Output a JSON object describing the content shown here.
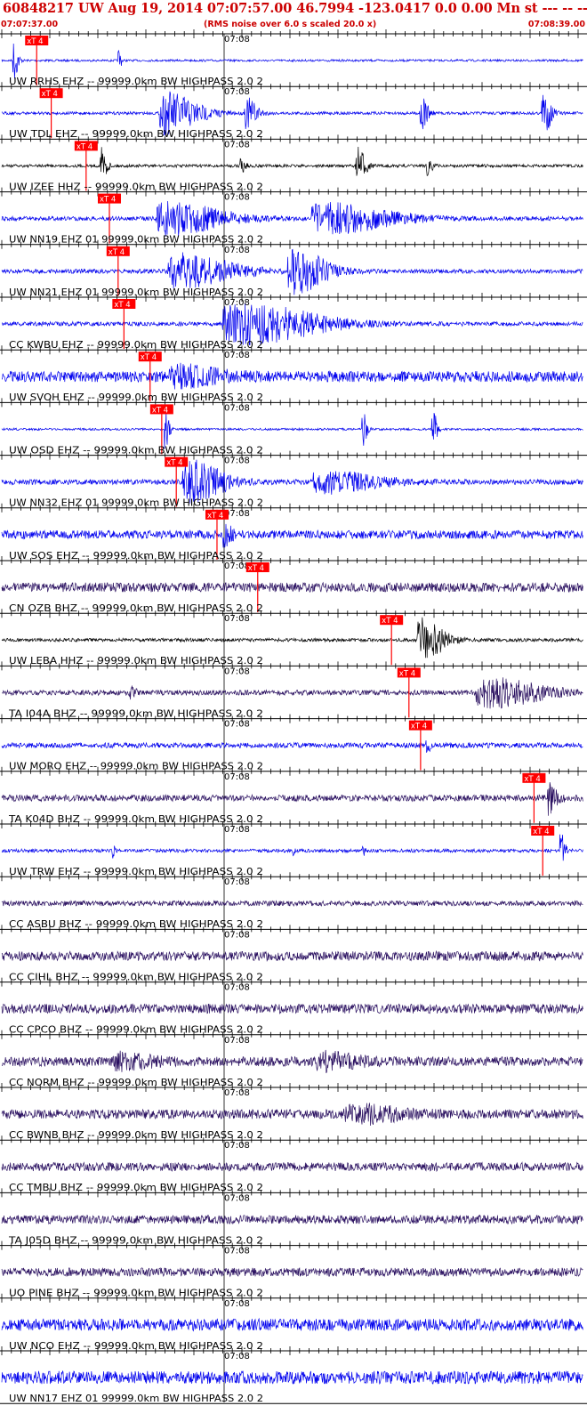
{
  "header": {
    "title": "60848217 UW Aug 19, 2014 07:07:57.00   46.7994 -123.0417  0.0 0.00 Mn st --- -- --  -1",
    "start_time": "07:07:37.00",
    "scale_note": "(RMS noise over 6.0 s scaled 20.0 x)",
    "end_time": "07:08:39.00"
  },
  "time_tick_label": "07:08",
  "pick_label": "xT 4",
  "colors": {
    "header_red": "#cc0000",
    "blue_trace": "#0000ee",
    "black_trace": "#000000",
    "purple_trace": "#2a1060",
    "pick_red": "#ff0000",
    "grid": "#000000"
  },
  "traces": [
    {
      "label": "UW RRHS EHZ -- 99999.0km BW  HIGHPASS  2.0  2",
      "color": "blue",
      "noise": 0.05,
      "bursts": [
        [
          0.02,
          0.8,
          1.0
        ],
        [
          0.2,
          0.5,
          0.6
        ]
      ],
      "pick": 0.06
    },
    {
      "label": "UW TDL EHZ -- 99999.0km BW  HIGHPASS  2.0  2",
      "color": "blue",
      "noise": 0.07,
      "bursts": [
        [
          0.28,
          6.0,
          1.0
        ],
        [
          0.42,
          2.0,
          0.7
        ],
        [
          0.72,
          1.2,
          0.9
        ],
        [
          0.93,
          1.5,
          1.0
        ]
      ],
      "pick": 0.085
    },
    {
      "label": "UW IZEE HHZ -- 99999.0km BW  HIGHPASS  2.0  2",
      "color": "black",
      "noise": 0.07,
      "bursts": [
        [
          0.17,
          1.0,
          1.0
        ],
        [
          0.41,
          0.8,
          0.5
        ],
        [
          0.61,
          1.5,
          0.9
        ],
        [
          0.73,
          1.0,
          0.5
        ]
      ],
      "pick": 0.145
    },
    {
      "label": "UW NN19 EHZ 01 99999.0km BW  HIGHPASS  2.0  2",
      "color": "blue",
      "noise": 0.1,
      "bursts": [
        [
          0.28,
          10.0,
          0.8
        ],
        [
          0.55,
          12.0,
          0.7
        ]
      ],
      "pick": 0.185
    },
    {
      "label": "UW NN21 EHZ 01 99999.0km BW  HIGHPASS  2.0  2",
      "color": "blue",
      "noise": 0.1,
      "bursts": [
        [
          0.3,
          10.0,
          0.8
        ],
        [
          0.5,
          6.0,
          1.0
        ]
      ],
      "pick": 0.2
    },
    {
      "label": "CC KWBU EHZ -- 99999.0km BW  HIGHPASS  2.0  2",
      "color": "blue",
      "noise": 0.1,
      "bursts": [
        [
          0.4,
          14.0,
          1.0
        ]
      ],
      "pick": 0.21
    },
    {
      "label": "UW SVOH EHZ -- 99999.0km BW  HIGHPASS  2.0  2",
      "color": "blue",
      "noise": 0.25,
      "bursts": [
        [
          0.3,
          8.0,
          0.4
        ]
      ],
      "pick": 0.255
    },
    {
      "label": "UW OSD EHZ -- 99999.0km BW  HIGHPASS  2.0  2",
      "color": "blue",
      "noise": 0.05,
      "bursts": [
        [
          0.28,
          0.8,
          0.9
        ],
        [
          0.62,
          0.8,
          0.9
        ],
        [
          0.74,
          0.8,
          1.0
        ]
      ],
      "pick": 0.275
    },
    {
      "label": "UW NN32 EHZ 01 99999.0km BW  HIGHPASS  2.0  2",
      "color": "blue",
      "noise": 0.12,
      "bursts": [
        [
          0.32,
          6.0,
          1.0
        ],
        [
          0.55,
          10.0,
          0.5
        ]
      ],
      "pick": 0.3
    },
    {
      "label": "UW SOS EHZ -- 99999.0km BW  HIGHPASS  2.0  2",
      "color": "blue",
      "noise": 0.2,
      "bursts": [
        [
          0.38,
          1.5,
          0.5
        ]
      ],
      "pick": 0.37
    },
    {
      "label": "CN OZB BHZ -- 99999.0km BW  HIGHPASS  2.0  2",
      "color": "purple",
      "noise": 0.22,
      "bursts": [],
      "pick": 0.44
    },
    {
      "label": "UW LEBA HHZ -- 99999.0km BW  HIGHPASS  2.0  2",
      "color": "black",
      "noise": 0.08,
      "bursts": [
        [
          0.72,
          4.0,
          1.0
        ]
      ],
      "pick": 0.67
    },
    {
      "label": "TA I04A BHZ -- 99999.0km BW  HIGHPASS  2.0  2",
      "color": "purple",
      "noise": 0.12,
      "bursts": [
        [
          0.83,
          10.0,
          0.65
        ],
        [
          0.22,
          1.0,
          0.3
        ]
      ],
      "pick": 0.7
    },
    {
      "label": "UW MORO EHZ -- 99999.0km BW  HIGHPASS  2.0  2",
      "color": "blue",
      "noise": 0.12,
      "bursts": [
        [
          0.73,
          0.5,
          0.7
        ]
      ],
      "pick": 0.72
    },
    {
      "label": "TA K04D BHZ -- 99999.0km BW  HIGHPASS  2.0  2",
      "color": "purple",
      "noise": 0.15,
      "bursts": [
        [
          0.94,
          1.5,
          1.0
        ]
      ],
      "pick": 0.915
    },
    {
      "label": "UW TRW EHZ -- 99999.0km BW  HIGHPASS  2.0  2",
      "color": "blue",
      "noise": 0.08,
      "bursts": [
        [
          0.19,
          0.3,
          0.4
        ],
        [
          0.5,
          0.3,
          0.4
        ],
        [
          0.62,
          0.3,
          0.5
        ],
        [
          0.96,
          0.8,
          0.9
        ]
      ],
      "pick": 0.93
    },
    {
      "label": "CC ASBU BHZ -- 99999.0km BW  HIGHPASS  2.0  2",
      "color": "purple",
      "noise": 0.12,
      "bursts": []
    },
    {
      "label": "CC CIHL BHZ -- 99999.0km BW  HIGHPASS  2.0  2",
      "color": "purple",
      "noise": 0.22,
      "bursts": []
    },
    {
      "label": "CC CPCO BHZ -- 99999.0km BW  HIGHPASS  2.0  2",
      "color": "purple",
      "noise": 0.22,
      "bursts": []
    },
    {
      "label": "CC NORM BHZ -- 99999.0km BW  HIGHPASS  2.0  2",
      "color": "purple",
      "noise": 0.22,
      "bursts": [
        [
          0.2,
          6.0,
          0.35
        ],
        [
          0.55,
          6.0,
          0.35
        ]
      ]
    },
    {
      "label": "CC BWNB BHZ -- 99999.0km BW  HIGHPASS  2.0  2",
      "color": "purple",
      "noise": 0.22,
      "bursts": [
        [
          0.6,
          8.0,
          0.4
        ]
      ]
    },
    {
      "label": "CC TMBU BHZ -- 99999.0km BW  HIGHPASS  2.0  2",
      "color": "purple",
      "noise": 0.2,
      "bursts": []
    },
    {
      "label": "TA J05D BHZ -- 99999.0km BW  HIGHPASS  2.0  2",
      "color": "purple",
      "noise": 0.2,
      "bursts": []
    },
    {
      "label": "UO PINE BHZ -- 99999.0km BW  HIGHPASS  2.0  2",
      "color": "purple",
      "noise": 0.2,
      "bursts": []
    },
    {
      "label": "UW NCO EHZ -- 99999.0km BW  HIGHPASS  2.0  2",
      "color": "blue",
      "noise": 0.28,
      "bursts": []
    },
    {
      "label": "UW NN17 EHZ 01 99999.0km BW  HIGHPASS  2.0  2",
      "color": "blue",
      "noise": 0.3,
      "bursts": []
    }
  ]
}
